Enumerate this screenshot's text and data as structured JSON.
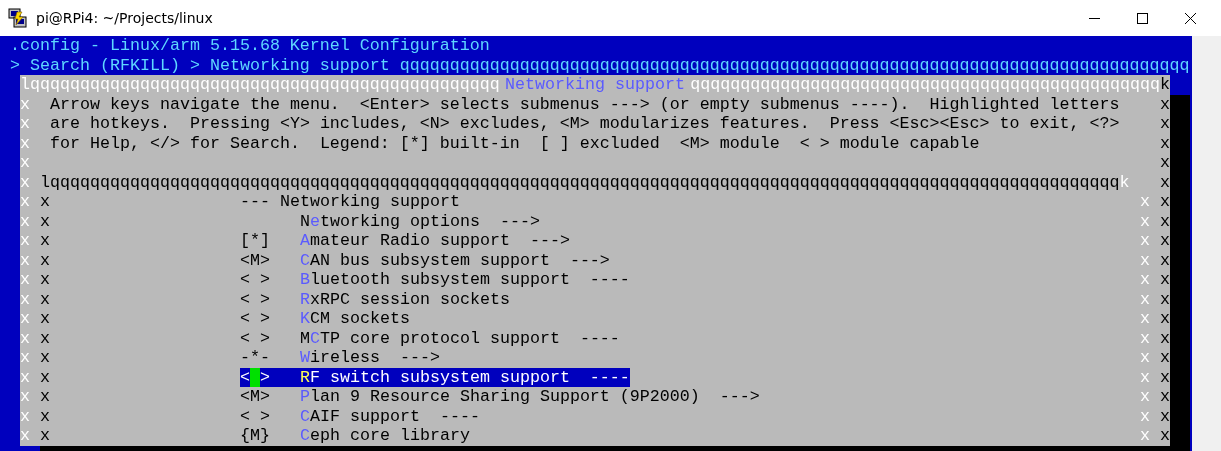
{
  "window": {
    "title": "pi@RPi4: ~/Projects/linux"
  },
  "terminal": {
    "header": ".config - Linux/arm 5.15.68 Kernel Configuration",
    "breadcrumb": "> Search (RFKILL) > Networking support",
    "breadcrumb_rule": "qqqqqqqqqqqqqqqqqqqqqqqqqqqqqqqqqqqqqqqqqqqqqqqqqqqqqqqqqqqqqqqqqqqqqqqqqqqqqqq",
    "dialog": {
      "top_rule_left": "lqqqqqqqqqqqqqqqqqqqqqqqqqqqqqqqqqqqqqqqqqqqqqqq",
      "title": "Networking support",
      "top_rule_right": "qqqqqqqqqqqqqqqqqqqqqqqqqqqqqqqqqqqqqqqqqqqqqqq",
      "top_corner": "k",
      "left_border": "xxxxxxxxxxxxxxxxxx",
      "right_border": "xxxxxxxxxxxxxxxxxx",
      "help": [
        "Arrow keys navigate the menu.  <Enter> selects submenus ---> (or empty submenus ----).  Highlighted letters",
        "are hotkeys.  Pressing <Y> includes, <N> excludes, <M> modularizes features.  Press <Esc><Esc> to exit, <?>",
        "for Help, </> for Search.  Legend: [*] built-in  [ ] excluded  <M> module  < > module capable"
      ],
      "menu": {
        "top_rule": "lqqqqqqqqqqqqqqqqqqqqqqqqqqqqqqqqqqqqqqqqqqqqqqqqqqqqqqqqqqqqqqqqqqqqqqqqqqqqqqqqqqqqqqqqqqqqqqqqqqqqqqqqqqq",
        "top_corner": "k",
        "left_border": "xxxxxxxxxxxxx",
        "right_border": "xxxxxxxxxxxxx",
        "items": [
          {
            "kind": "header",
            "text": "--- Networking support"
          },
          {
            "kind": "option",
            "label_start": "N",
            "hotkey": "e",
            "label_end": "tworking options  --->",
            "selected": false
          },
          {
            "kind": "option",
            "prompt": "[*]",
            "hotkey": "A",
            "label_end": "mateur Radio support  --->",
            "selected": false
          },
          {
            "kind": "option",
            "prompt": "<M>",
            "hotkey": "C",
            "label_end": "AN bus subsystem support  --->",
            "selected": false
          },
          {
            "kind": "option",
            "prompt": "< >",
            "hotkey": "B",
            "label_end": "luetooth subsystem support  ----",
            "selected": false
          },
          {
            "kind": "option",
            "prompt": "< >",
            "hotkey": "R",
            "label_end": "xRPC session sockets",
            "selected": false
          },
          {
            "kind": "option",
            "prompt": "< >",
            "hotkey": "K",
            "label_end": "CM sockets",
            "selected": false
          },
          {
            "kind": "option",
            "prompt": "< >",
            "label_start": "M",
            "hotkey": "C",
            "label_end": "TP core protocol support  ----",
            "selected": false
          },
          {
            "kind": "option",
            "prompt": "-*-",
            "hotkey": "W",
            "label_end": "ireless  --->",
            "selected": false
          },
          {
            "kind": "option",
            "prompt": "< >",
            "hotkey": "R",
            "label_end": "F switch subsystem support  ----",
            "selected": true
          },
          {
            "kind": "option",
            "prompt": "<M>",
            "hotkey": "P",
            "label_end": "lan 9 Resource Sharing Support (9P2000)  --->",
            "selected": false
          },
          {
            "kind": "option",
            "prompt": "< >",
            "hotkey": "C",
            "label_end": "AIF support  ----",
            "selected": false
          },
          {
            "kind": "option",
            "prompt": "{M}",
            "hotkey": "C",
            "label_end": "eph core library",
            "selected": false
          }
        ]
      }
    }
  }
}
